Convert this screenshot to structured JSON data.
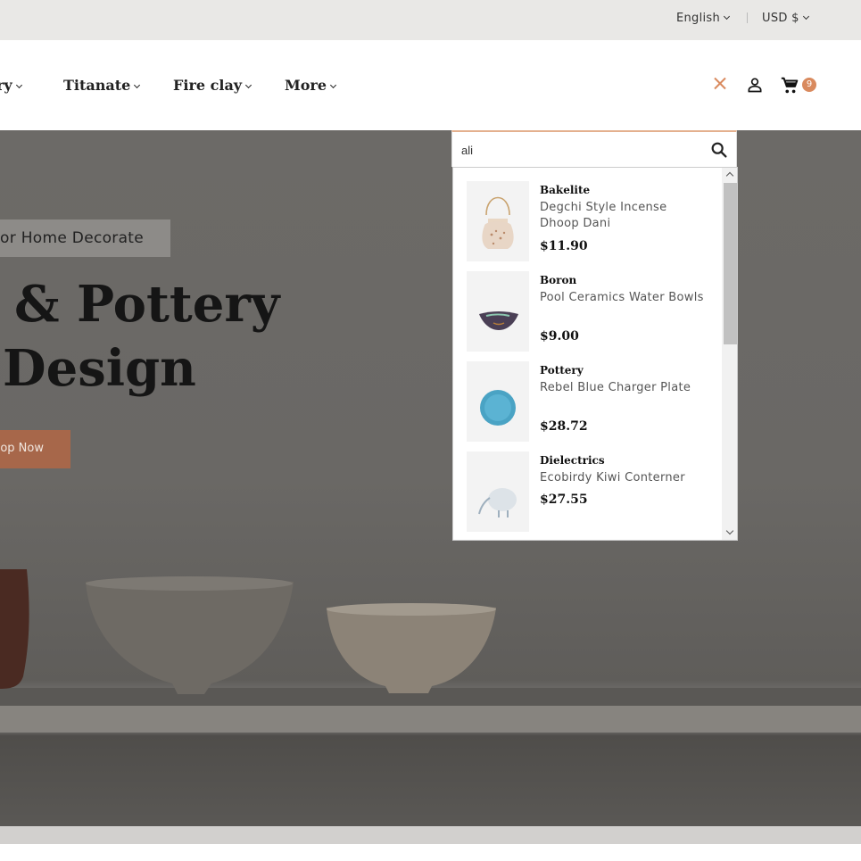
{
  "topbar": {
    "language": "English",
    "currency": "USD $"
  },
  "nav": {
    "items": [
      {
        "label": "ry"
      },
      {
        "label": "Titanate"
      },
      {
        "label": "Fire clay"
      },
      {
        "label": "More"
      }
    ],
    "cart_count": "9",
    "icons": {
      "close": "close-icon",
      "account": "user-icon",
      "cart": "cart-icon"
    }
  },
  "hero": {
    "badge": "or Home Decorate",
    "title_line1": "& Pottery",
    "title_line2": "Design",
    "button_label": "op Now"
  },
  "search": {
    "query": "ali",
    "results": [
      {
        "category": "Bakelite",
        "name": "Degchi Style Incense Dhoop Dani",
        "price": "$11.90"
      },
      {
        "category": "Boron",
        "name": "Pool Ceramics Water Bowls",
        "price": "$9.00"
      },
      {
        "category": "Pottery",
        "name": "Rebel Blue Charger Plate",
        "price": "$28.72"
      },
      {
        "category": "Dielectrics",
        "name": "Ecobirdy Kiwi Conterner",
        "price": "$27.55"
      }
    ]
  },
  "colors": {
    "accent": "#d98a5e",
    "hero_button": "#a7674a",
    "topbar_bg": "#e9e8e6"
  }
}
